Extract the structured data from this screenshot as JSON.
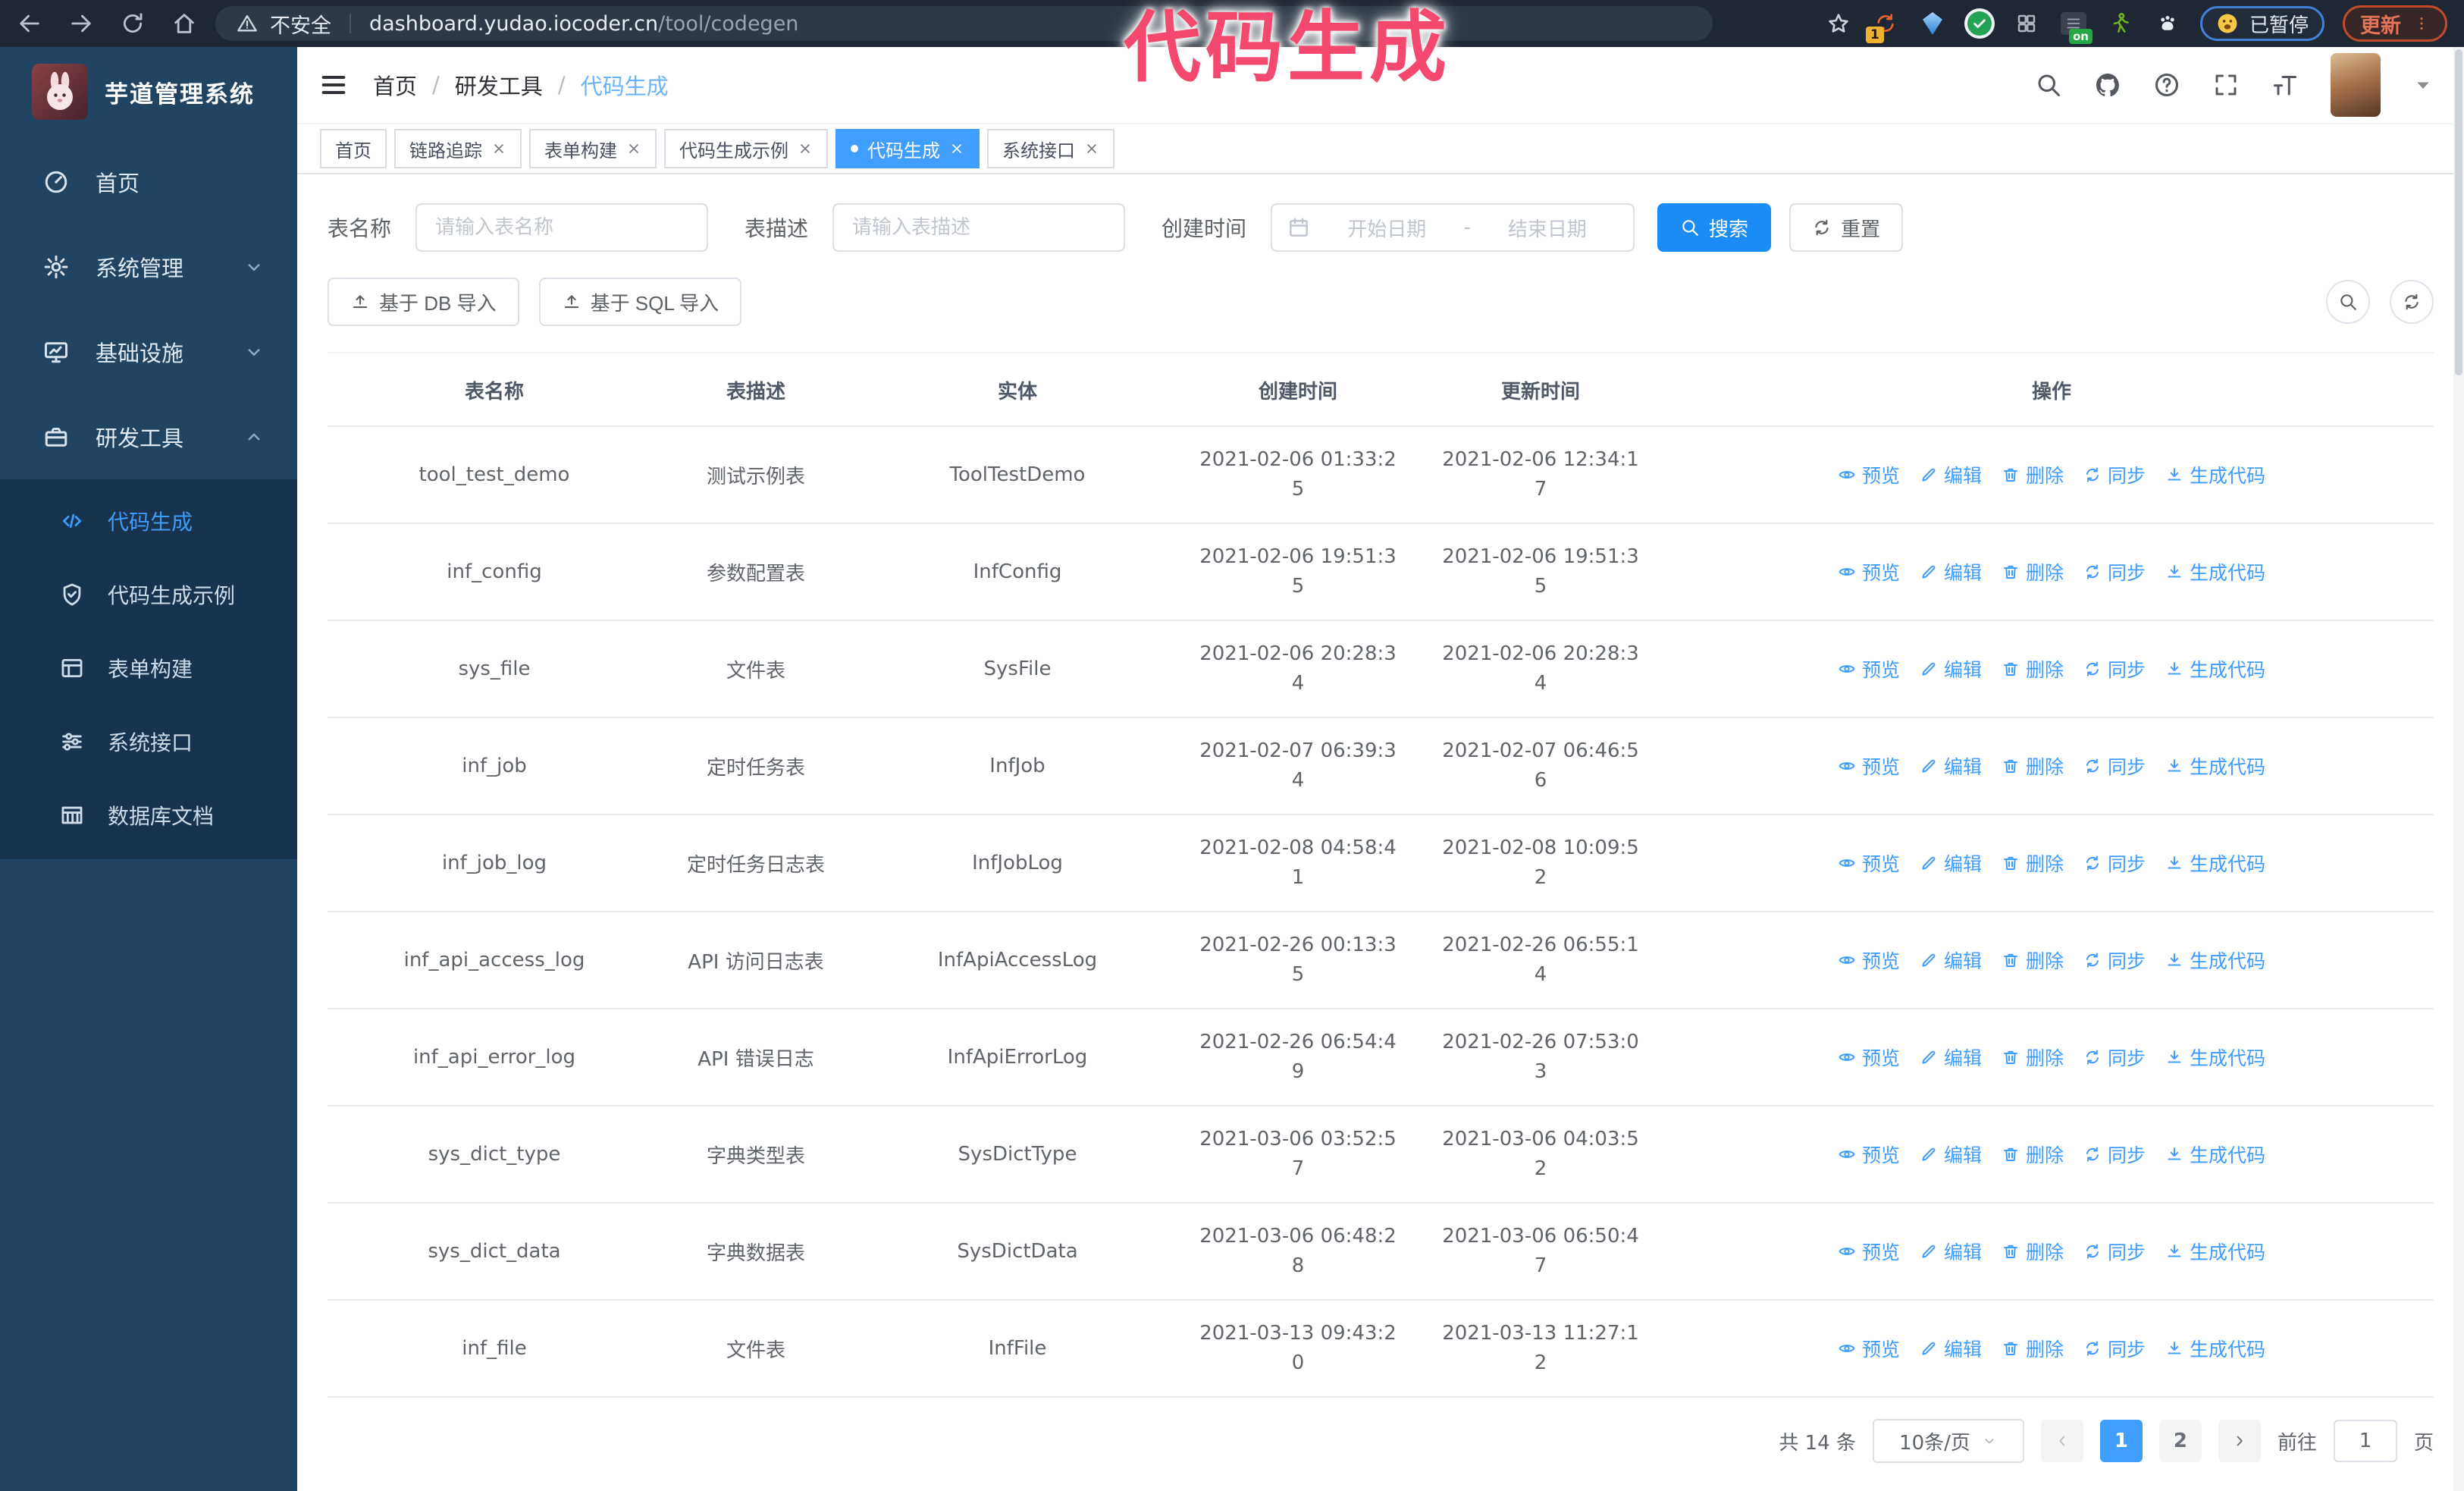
{
  "browser": {
    "security_label": "不安全",
    "url_host": "dashboard.yudao.iocoder.cn",
    "url_path": "/tool/codegen",
    "ext_count_badge": "1",
    "ext_on_badge": "on",
    "paused_badge": "已暂停",
    "update_label": "更新"
  },
  "annotation": {
    "text": "代码生成",
    "color": "#f4486e"
  },
  "sidebar": {
    "logo_title": "芋道管理系统",
    "items": [
      {
        "label": "首页"
      },
      {
        "label": "系统管理"
      },
      {
        "label": "基础设施"
      },
      {
        "label": "研发工具"
      }
    ],
    "subitems": [
      {
        "label": "代码生成"
      },
      {
        "label": "代码生成示例"
      },
      {
        "label": "表单构建"
      },
      {
        "label": "系统接口"
      },
      {
        "label": "数据库文档"
      }
    ],
    "active_subitem": "代码生成"
  },
  "navbar": {
    "breadcrumb": [
      "首页",
      "研发工具",
      "代码生成"
    ],
    "separator": "/"
  },
  "tabs": [
    {
      "label": "首页"
    },
    {
      "label": "链路追踪"
    },
    {
      "label": "表单构建"
    },
    {
      "label": "代码生成示例"
    },
    {
      "label": "代码生成"
    },
    {
      "label": "系统接口"
    }
  ],
  "filters": {
    "name_label": "表名称",
    "name_placeholder": "请输入表名称",
    "desc_label": "表描述",
    "desc_placeholder": "请输入表描述",
    "time_label": "创建时间",
    "start_placeholder": "开始日期",
    "range_separator": "-",
    "end_placeholder": "结束日期",
    "search_label": "搜索",
    "reset_label": "重置"
  },
  "toolbar": {
    "import_db_label": "基于 DB 导入",
    "import_sql_label": "基于 SQL 导入"
  },
  "table": {
    "headers": [
      "表名称",
      "表描述",
      "实体",
      "创建时间",
      "更新时间",
      "操作"
    ],
    "action_labels": [
      "预览",
      "编辑",
      "删除",
      "同步",
      "生成代码"
    ],
    "rows": [
      {
        "name": "tool_test_demo",
        "desc": "测试示例表",
        "entity": "ToolTestDemo",
        "created": "2021-02-06 01:33:25",
        "updated": "2021-02-06 12:34:17"
      },
      {
        "name": "inf_config",
        "desc": "参数配置表",
        "entity": "InfConfig",
        "created": "2021-02-06 19:51:35",
        "updated": "2021-02-06 19:51:35"
      },
      {
        "name": "sys_file",
        "desc": "文件表",
        "entity": "SysFile",
        "created": "2021-02-06 20:28:34",
        "updated": "2021-02-06 20:28:34"
      },
      {
        "name": "inf_job",
        "desc": "定时任务表",
        "entity": "InfJob",
        "created": "2021-02-07 06:39:34",
        "updated": "2021-02-07 06:46:56"
      },
      {
        "name": "inf_job_log",
        "desc": "定时任务日志表",
        "entity": "InfJobLog",
        "created": "2021-02-08 04:58:41",
        "updated": "2021-02-08 10:09:52"
      },
      {
        "name": "inf_api_access_log",
        "desc": "API 访问日志表",
        "entity": "InfApiAccessLog",
        "created": "2021-02-26 00:13:35",
        "updated": "2021-02-26 06:55:14"
      },
      {
        "name": "inf_api_error_log",
        "desc": "API 错误日志",
        "entity": "InfApiErrorLog",
        "created": "2021-02-26 06:54:49",
        "updated": "2021-02-26 07:53:03"
      },
      {
        "name": "sys_dict_type",
        "desc": "字典类型表",
        "entity": "SysDictType",
        "created": "2021-03-06 03:52:57",
        "updated": "2021-03-06 04:03:52"
      },
      {
        "name": "sys_dict_data",
        "desc": "字典数据表",
        "entity": "SysDictData",
        "created": "2021-03-06 06:48:28",
        "updated": "2021-03-06 06:50:47"
      },
      {
        "name": "inf_file",
        "desc": "文件表",
        "entity": "InfFile",
        "created": "2021-03-13 09:43:20",
        "updated": "2021-03-13 11:27:12"
      }
    ]
  },
  "pagination": {
    "total_label": "共 14 条",
    "page_size_label": "10条/页",
    "pages": [
      "1",
      "2"
    ],
    "active_page": "1",
    "goto_label": "前往",
    "goto_value": "1",
    "page_unit_label": "页"
  },
  "colors": {
    "accent": "#409eff",
    "sidebar_bg": "#214463",
    "submenu_bg": "#17334e",
    "annotation": "#f4486e"
  }
}
